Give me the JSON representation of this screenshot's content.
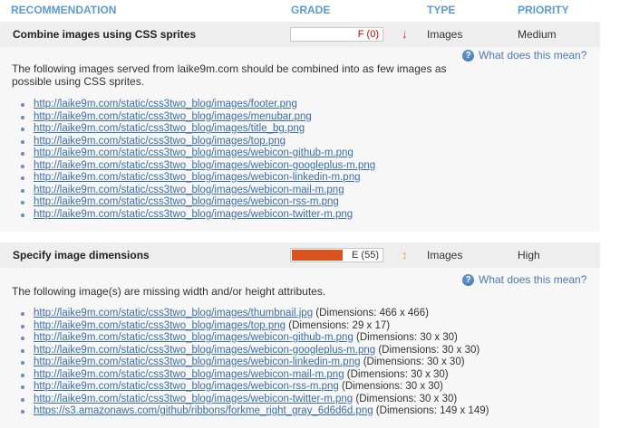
{
  "header": {
    "recommendation": "RECOMMENDATION",
    "grade": "GRADE",
    "type": "TYPE",
    "priority": "PRIORITY"
  },
  "colors": {
    "header": "#5b9bd5",
    "grade_f_text": "#cc0000",
    "grade_e_fill": "#d9531e",
    "link": "#3a6ea8"
  },
  "rules": [
    {
      "name": "Combine images using CSS sprites",
      "grade": "F (0)",
      "grade_score": 0,
      "trend_icon": "arrow-down-icon",
      "type": "Images",
      "priority": "Medium",
      "help": "What does this mean?",
      "description": "The following images served from laike9m.com should be combined into as few images as possible using CSS sprites.",
      "urls": [
        {
          "url": "http://laike9m.com/static/css3two_blog/images/footer.png",
          "note": ""
        },
        {
          "url": "http://laike9m.com/static/css3two_blog/images/menubar.png",
          "note": ""
        },
        {
          "url": "http://laike9m.com/static/css3two_blog/images/title_bg.png",
          "note": ""
        },
        {
          "url": "http://laike9m.com/static/css3two_blog/images/top.png",
          "note": ""
        },
        {
          "url": "http://laike9m.com/static/css3two_blog/images/webicon-github-m.png",
          "note": ""
        },
        {
          "url": "http://laike9m.com/static/css3two_blog/images/webicon-googleplus-m.png",
          "note": ""
        },
        {
          "url": "http://laike9m.com/static/css3two_blog/images/webicon-linkedin-m.png",
          "note": ""
        },
        {
          "url": "http://laike9m.com/static/css3two_blog/images/webicon-mail-m.png",
          "note": ""
        },
        {
          "url": "http://laike9m.com/static/css3two_blog/images/webicon-rss-m.png",
          "note": ""
        },
        {
          "url": "http://laike9m.com/static/css3two_blog/images/webicon-twitter-m.png",
          "note": ""
        }
      ]
    },
    {
      "name": "Specify image dimensions",
      "grade": "E (55)",
      "grade_score": 55,
      "trend_icon": "arrow-up-down-icon",
      "type": "Images",
      "priority": "High",
      "help": "What does this mean?",
      "description": "The following image(s) are missing width and/or height attributes.",
      "urls": [
        {
          "url": "http://laike9m.com/static/css3two_blog/images/thumbnail.jpg",
          "note": " (Dimensions: 466 x 466)"
        },
        {
          "url": "http://laike9m.com/static/css3two_blog/images/top.png",
          "note": " (Dimensions: 29 x 17)"
        },
        {
          "url": "http://laike9m.com/static/css3two_blog/images/webicon-github-m.png",
          "note": " (Dimensions: 30 x 30)"
        },
        {
          "url": "http://laike9m.com/static/css3two_blog/images/webicon-googleplus-m.png",
          "note": " (Dimensions: 30 x 30)"
        },
        {
          "url": "http://laike9m.com/static/css3two_blog/images/webicon-linkedin-m.png",
          "note": " (Dimensions: 30 x 30)"
        },
        {
          "url": "http://laike9m.com/static/css3two_blog/images/webicon-mail-m.png",
          "note": " (Dimensions: 30 x 30)"
        },
        {
          "url": "http://laike9m.com/static/css3two_blog/images/webicon-rss-m.png",
          "note": " (Dimensions: 30 x 30)"
        },
        {
          "url": "http://laike9m.com/static/css3two_blog/images/webicon-twitter-m.png",
          "note": " (Dimensions: 30 x 30)"
        },
        {
          "url": "https://s3.amazonaws.com/github/ribbons/forkme_right_gray_6d6d6d.png",
          "note": " (Dimensions: 149 x 149)"
        }
      ]
    }
  ]
}
